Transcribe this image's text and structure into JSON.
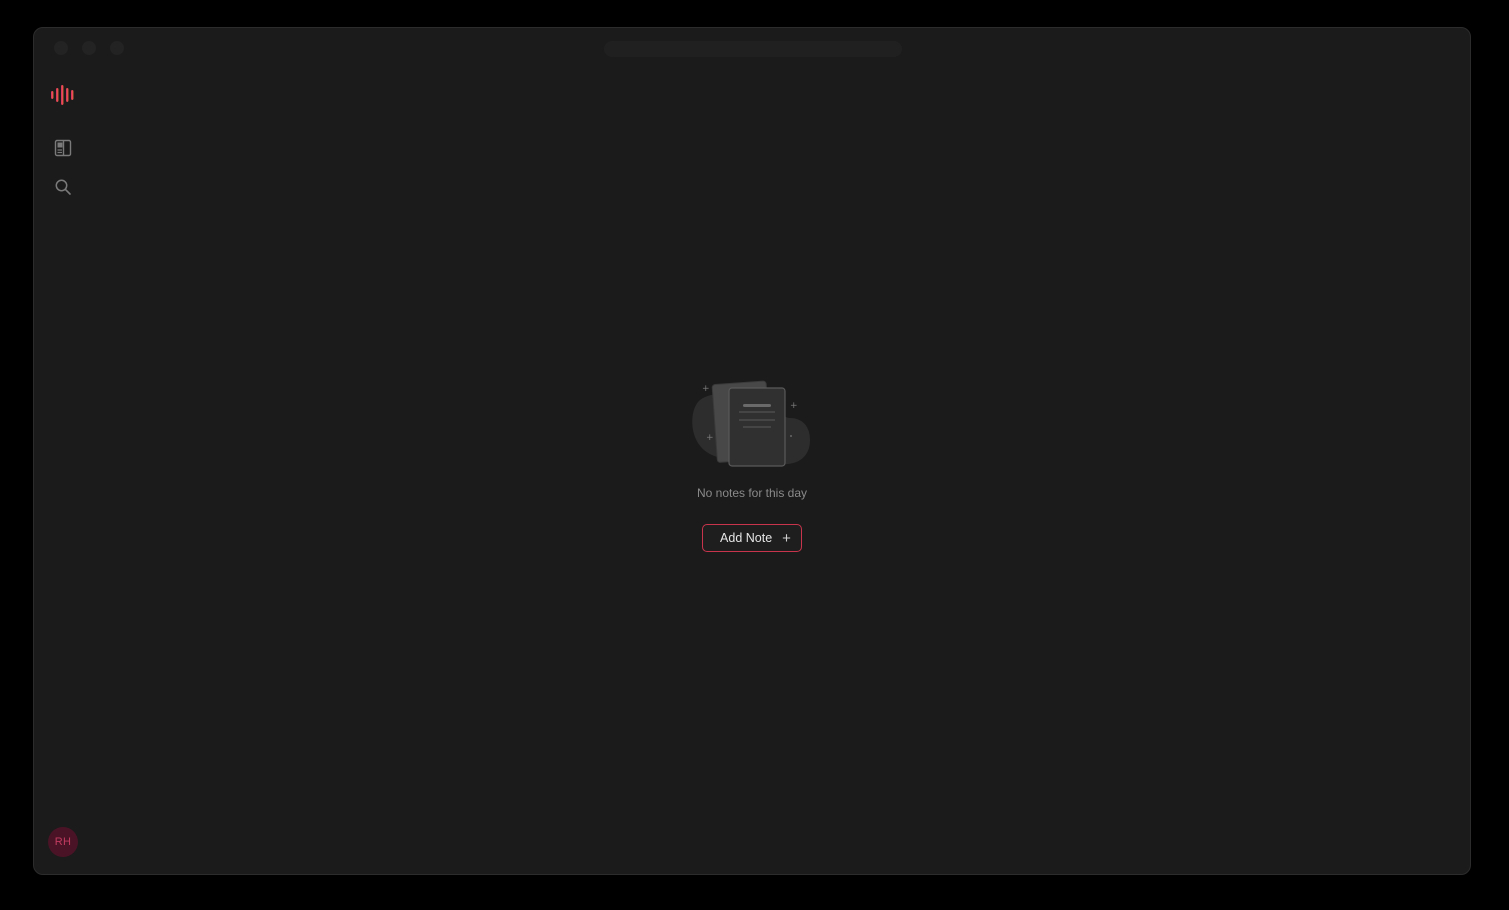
{
  "sidebar": {
    "avatar_initials": "RH",
    "icons": [
      "panel-icon",
      "search-icon"
    ]
  },
  "main": {
    "empty_message": "No notes for this day",
    "add_button_label": "Add Note",
    "add_button_icon": "+"
  },
  "colors": {
    "accent": "#c7344b",
    "avatar_bg": "#4a1426",
    "avatar_text": "#c23a60",
    "window_bg": "#1b1b1b"
  }
}
